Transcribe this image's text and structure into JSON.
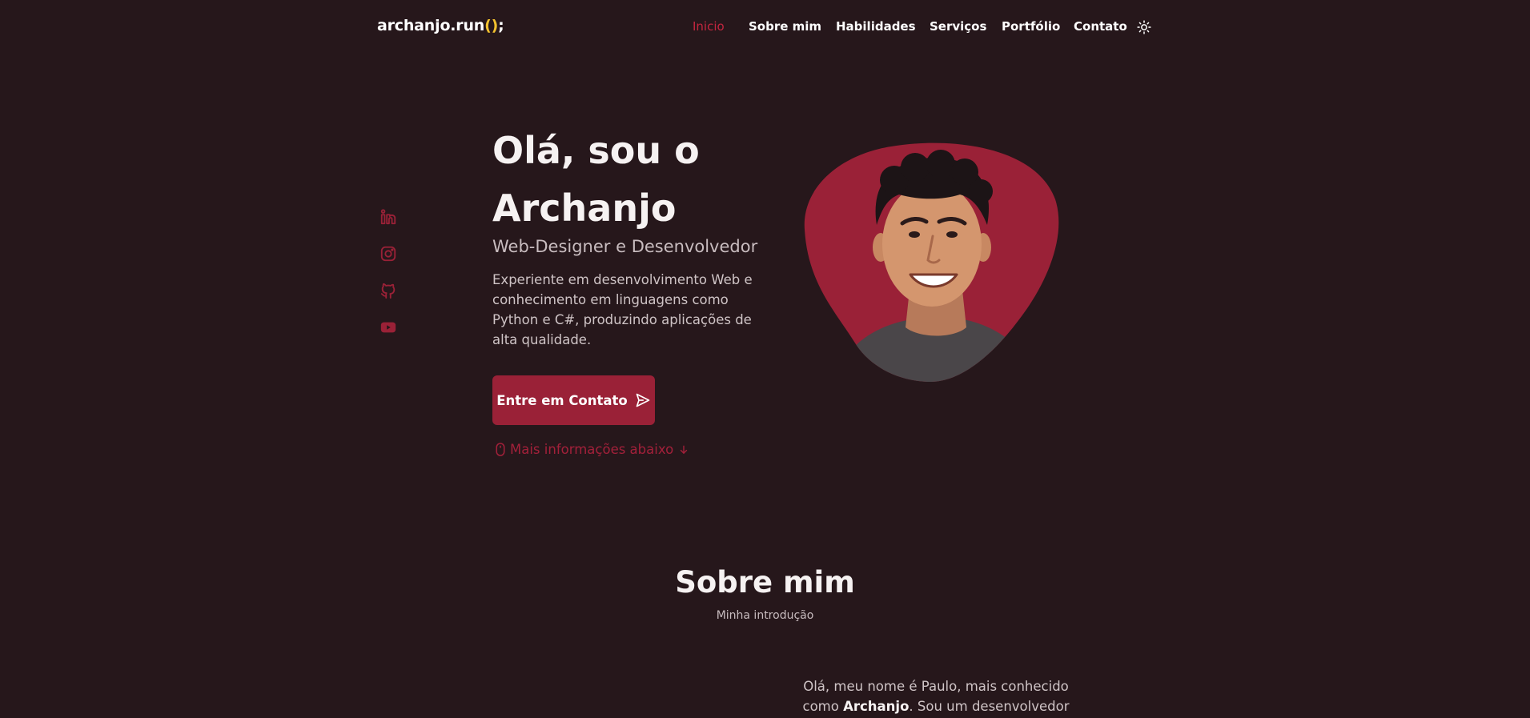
{
  "header": {
    "logo_text": "archanjo.run",
    "logo_parens": "()",
    "logo_semicolon": ";",
    "nav": [
      {
        "label": "Inicio",
        "active": true
      },
      {
        "label": "Sobre mim"
      },
      {
        "label": "Habilidades"
      },
      {
        "label": "Serviços"
      },
      {
        "label": "Portfólio"
      },
      {
        "label": "Contato"
      }
    ],
    "theme_icon": "sun-icon"
  },
  "social": [
    "linkedin-icon",
    "instagram-icon",
    "github-icon",
    "youtube-icon"
  ],
  "hero": {
    "title_line1": "Olá, sou o",
    "title_line2": "Archanjo",
    "subtitle": "Web-Designer e Desenvolvedor",
    "description": "Experiente em desenvolvimento Web e conhecimento em linguagens como Python e C#, produzindo aplicações de alta qualidade.",
    "button_label": "Entre em Contato",
    "scroll_label": "Mais informações abaixo"
  },
  "about": {
    "title": "Sobre mim",
    "subtitle": "Minha introdução",
    "text_before": "Olá, meu nome é Paulo, mais conhecido como ",
    "text_name": "Archanjo",
    "text_after": ". Sou um desenvolvedor de"
  },
  "colors": {
    "background": "#26171b",
    "accent": "#9a2137",
    "accent_text": "#c3263f",
    "logo_paren": "#f2c12e"
  }
}
